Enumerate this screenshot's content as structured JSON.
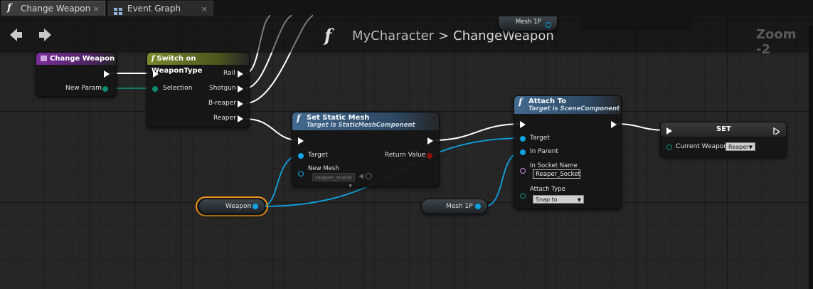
{
  "tabs": [
    {
      "label": "Change Weapon",
      "icon": "function-icon",
      "close": "×",
      "active": true
    },
    {
      "label": "Event Graph",
      "icon": "graph-icon",
      "close": "×",
      "active": false
    }
  ],
  "toolbar": {
    "back": "◆",
    "forward": "◆",
    "breadcrumb_icon": "f",
    "breadcrumb_root": "MyCharacter",
    "breadcrumb_sep": ">",
    "breadcrumb_current": "ChangeWeapon",
    "zoom": "Zoom -2"
  },
  "offscreen": {
    "mesh1p_top_label": "Mesh 1P"
  },
  "nodes": {
    "change_weapon": {
      "title": "Change Weapon",
      "param": "New Param"
    },
    "switch": {
      "title": "Switch on WeaponType",
      "selection": "Selection",
      "outputs": [
        "Rail",
        "Shotgun",
        "B-reaper",
        "Reaper"
      ]
    },
    "set_static_mesh": {
      "title": "Set Static Mesh",
      "subtitle": "Target is StaticMeshComponent",
      "target": "Target",
      "return": "Return Value",
      "new_mesh": "New Mesh",
      "mesh_value": "reaper_mesh"
    },
    "attach_to": {
      "title": "Attach To",
      "subtitle": "Target is SceneComponent",
      "target": "Target",
      "in_parent": "In Parent",
      "socket_label": "In Socket Name",
      "socket_value": "Reaper_Socket",
      "attach_type_label": "Attach Type",
      "attach_type_value": "Snap to Target"
    },
    "set": {
      "title": "SET",
      "var": "Current Weapon",
      "value": "Reaper"
    },
    "weapon_var": {
      "label": "Weapon"
    },
    "mesh1p_var": {
      "label": "Mesh 1P"
    }
  },
  "colors": {
    "function_header": "#3d5f80",
    "event_header": "#6b2a86",
    "switch_header": "#66712a",
    "object_pin": "#0ea3e0",
    "enum_pin": "#0e8a72",
    "name_pin": "#c88ae6",
    "return_pin": "#8c0f0f",
    "selected_outline": "#f29a1a"
  }
}
